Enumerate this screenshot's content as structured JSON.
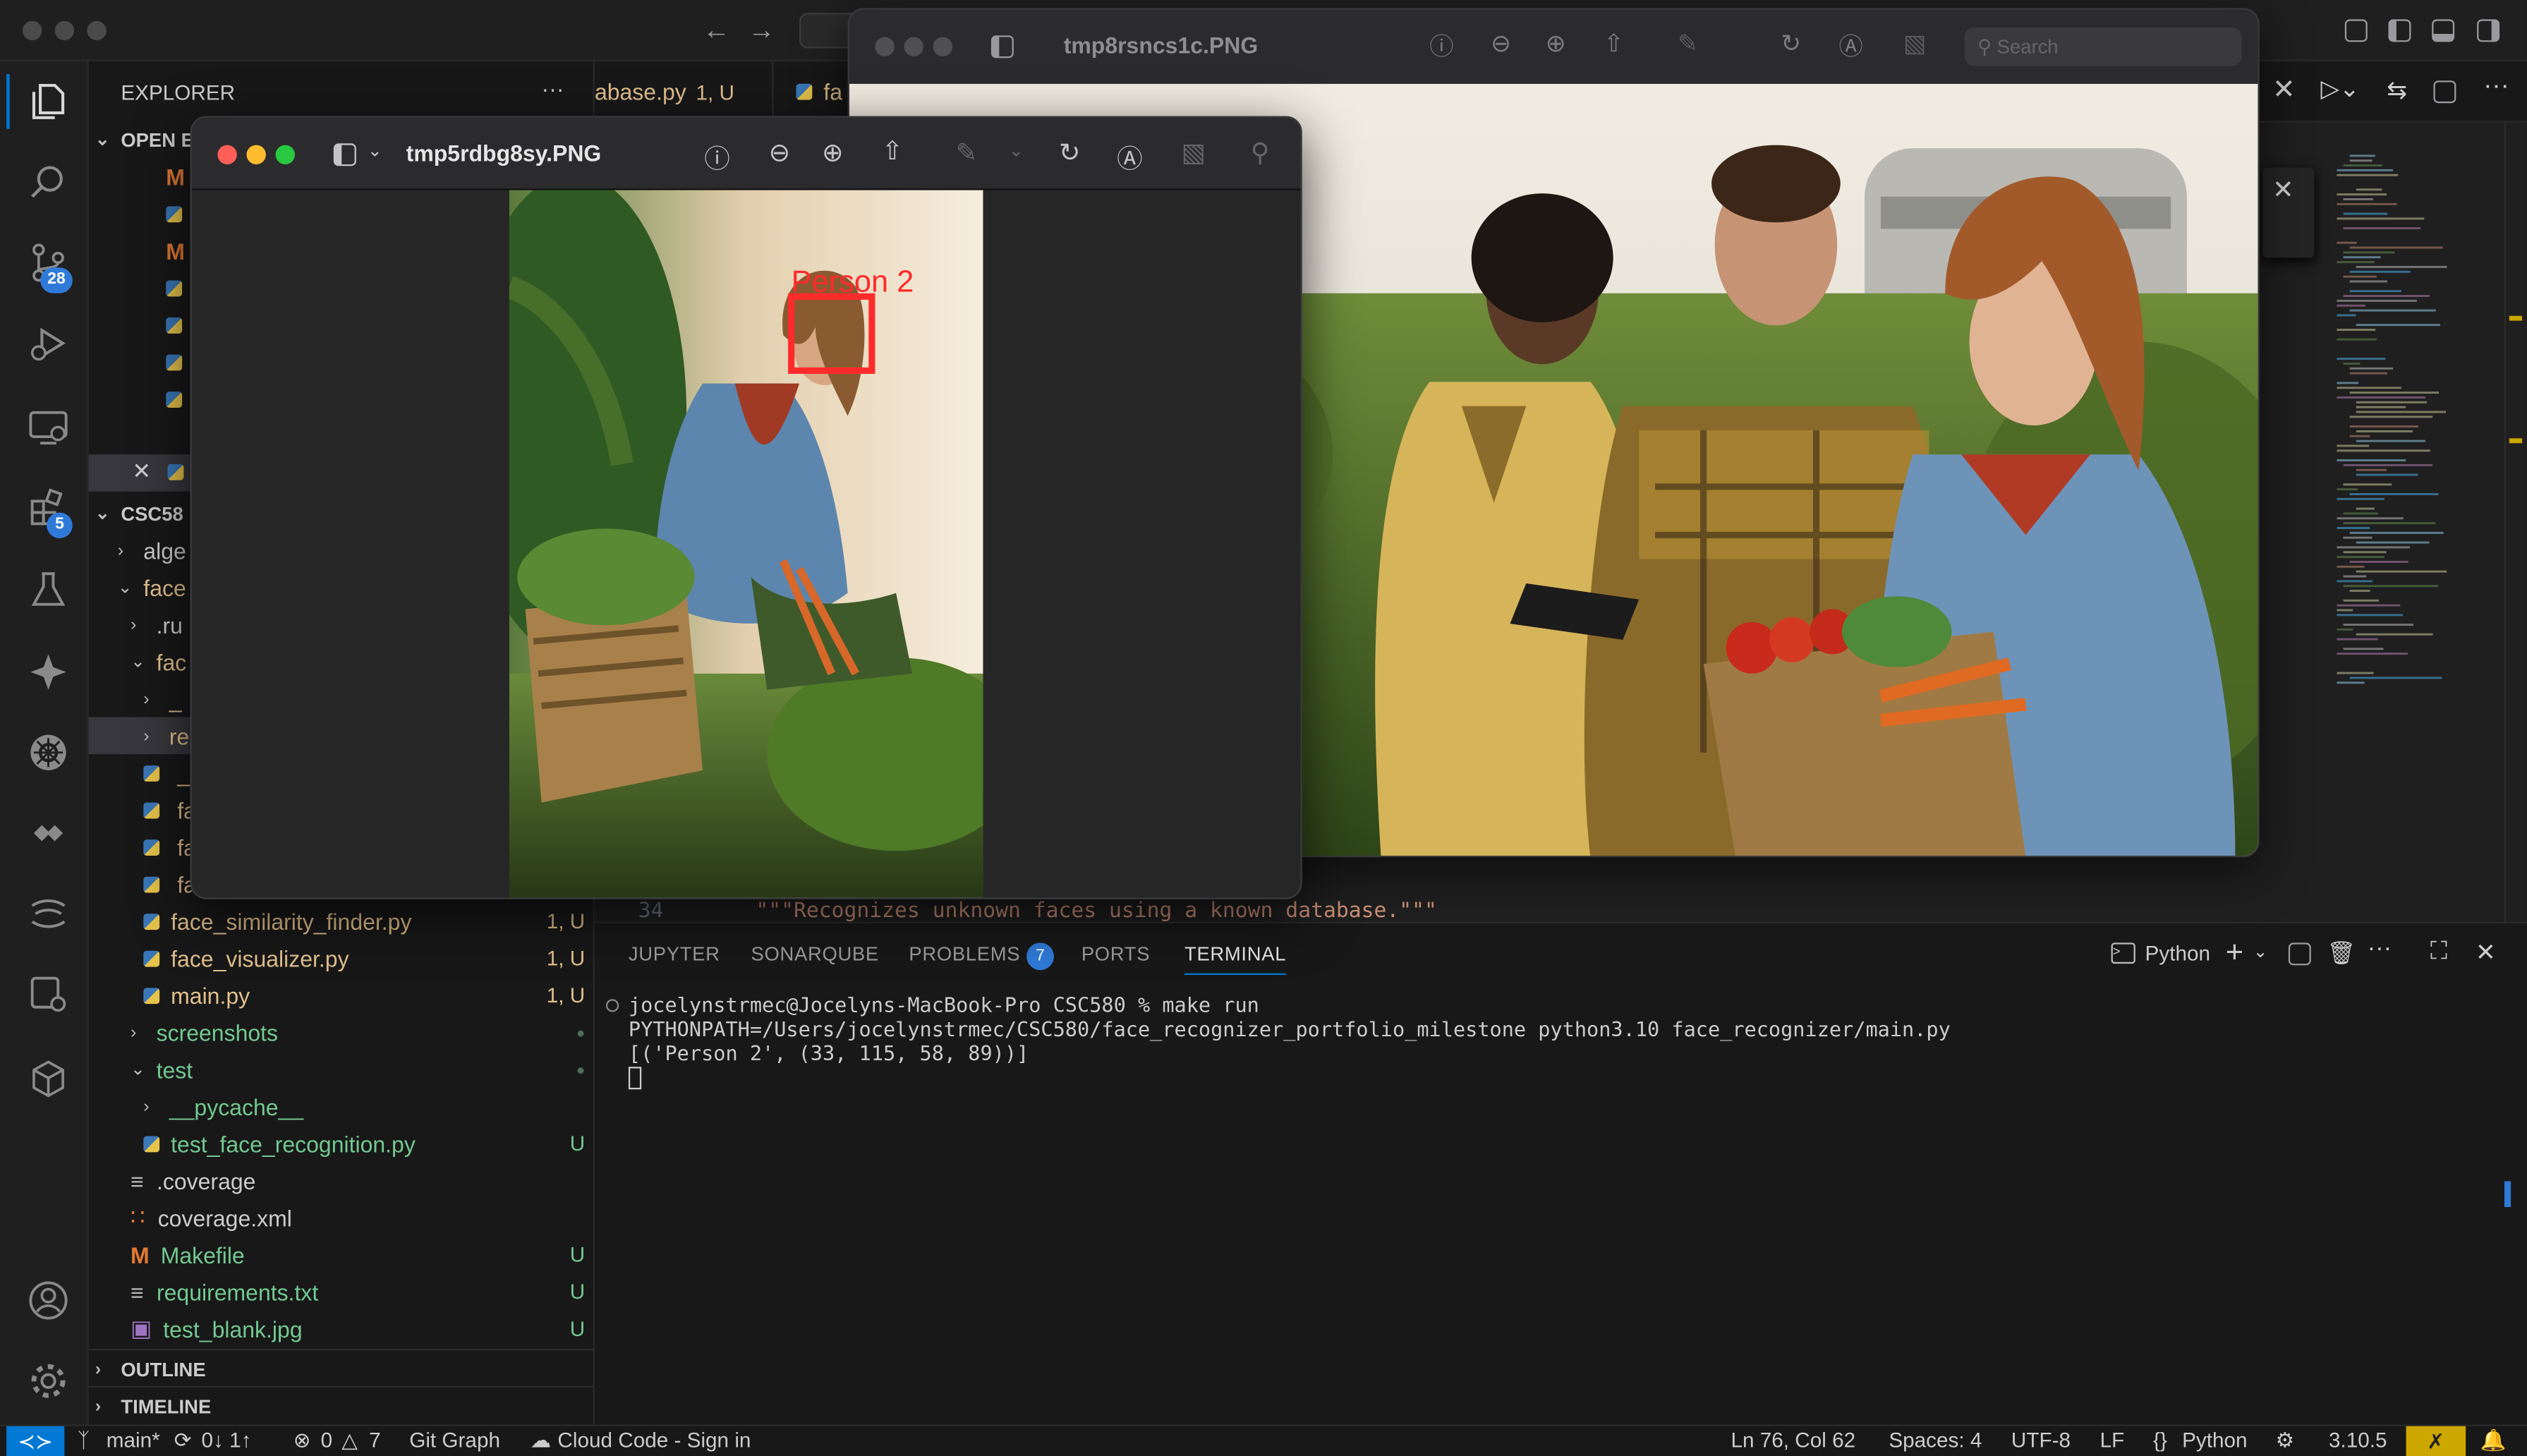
{
  "explorer": {
    "title": "EXPLORER",
    "more": "···",
    "open_editors": "OPEN E",
    "open_items": [
      "M",
      "",
      "M",
      "",
      "",
      "",
      "",
      ""
    ],
    "folder": "CSC58",
    "tree": [
      {
        "label": "alge",
        "type": "folder-closed"
      },
      {
        "label": "face",
        "type": "folder-open"
      },
      {
        "label": ".ru",
        "type": "folder-closed"
      },
      {
        "label": "fac",
        "type": "folder-open"
      },
      {
        "label": "_",
        "type": "folder-closed"
      },
      {
        "label": "re",
        "type": "folder-closed"
      },
      {
        "label": "_",
        "type": "py"
      },
      {
        "label": "fa",
        "type": "py"
      },
      {
        "label": "fa",
        "type": "py"
      },
      {
        "label": "fa",
        "type": "py"
      }
    ],
    "files": [
      {
        "name": "face_similarity_finder.py",
        "status": "1, U",
        "icon": "py",
        "color": "#e2c08d"
      },
      {
        "name": "face_visualizer.py",
        "status": "1, U",
        "icon": "py",
        "color": "#e2c08d"
      },
      {
        "name": "main.py",
        "status": "1, U",
        "icon": "py",
        "color": "#e2c08d"
      },
      {
        "name": "screenshots",
        "status": "●",
        "icon": "folder-closed",
        "color": "#73c991"
      },
      {
        "name": "test",
        "status": "●",
        "icon": "folder-open",
        "color": "#73c991"
      },
      {
        "name": "__pycache__",
        "status": "",
        "icon": "folder-closed",
        "color": "#73c991"
      },
      {
        "name": "test_face_recognition.py",
        "status": "U",
        "icon": "py",
        "color": "#73c991"
      },
      {
        "name": ".coverage",
        "status": "",
        "icon": "text",
        "color": "#cccccc"
      },
      {
        "name": "coverage.xml",
        "status": "",
        "icon": "rss",
        "color": "#cccccc"
      },
      {
        "name": "Makefile",
        "status": "U",
        "icon": "make",
        "color": "#73c991"
      },
      {
        "name": "requirements.txt",
        "status": "U",
        "icon": "text",
        "color": "#73c991"
      },
      {
        "name": "test_blank.jpg",
        "status": "U",
        "icon": "image",
        "color": "#73c991"
      }
    ],
    "outline": "OUTLINE",
    "timeline": "TIMELINE"
  },
  "activity": {
    "scm_badge": "28",
    "ext_badge": "5"
  },
  "editor": {
    "tab1": "abase.py",
    "tab1_status": "1, U",
    "tab2": "fa",
    "line_no": "34",
    "code_line": "\"\"\"Recognizes unknown faces using a known database.\"\"\""
  },
  "panel": {
    "tabs": [
      "JUPYTER",
      "SONARQUBE",
      "PROBLEMS",
      "PORTS",
      "TERMINAL"
    ],
    "problems_count": "7",
    "active": "TERMINAL",
    "shell": "Python",
    "terminal_lines": [
      "jocelynstrmec@Jocelyns-MacBook-Pro CSC580 % make run",
      "PYTHONPATH=/Users/jocelynstrmec/CSC580/face_recognizer_portfolio_milestone python3.10 face_recognizer/main.py",
      "[('Person 2', (33, 115, 58, 89))]"
    ]
  },
  "status": {
    "branch": "main*",
    "sync": "0↓ 1↑",
    "errors": "0",
    "warnings": "7",
    "git_graph": "Git Graph",
    "cloud": "Cloud Code - Sign in",
    "position": "Ln 76, Col 62",
    "spaces": "Spaces: 4",
    "encoding": "UTF-8",
    "eol": "LF",
    "language": "Python",
    "version": "3.10.5"
  },
  "preview_back": {
    "title": "tmp8rsncs1c.PNG",
    "search_placeholder": "Search"
  },
  "preview_front": {
    "title": "tmp5rdbg8sy.PNG",
    "face_label": "Person 2"
  },
  "colors": {
    "accent": "#0078d4",
    "badge": "#2f7ad8",
    "git_untracked": "#73c991",
    "git_modified": "#e2c08d",
    "face_box": "#ff2b2b"
  }
}
